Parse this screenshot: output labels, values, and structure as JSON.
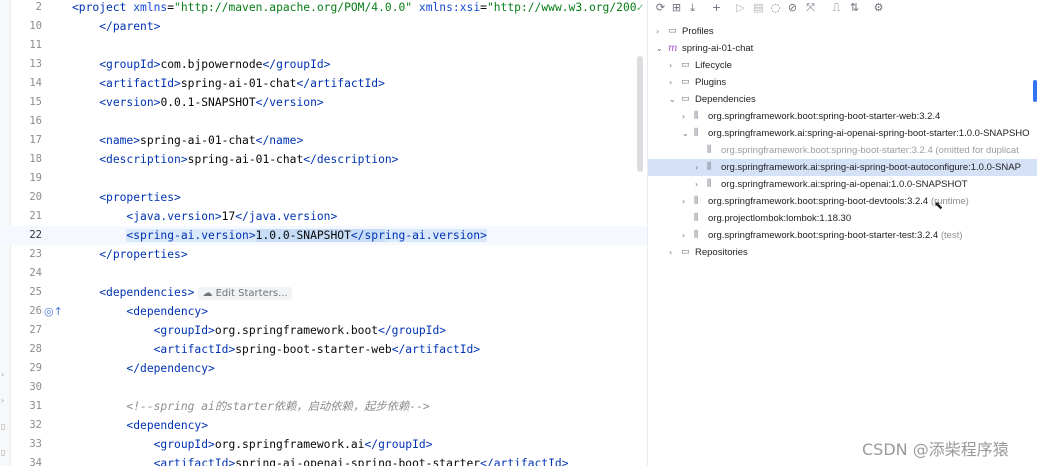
{
  "editor": {
    "lines": [
      {
        "num": "2",
        "parts": [
          [
            "tg",
            "<project "
          ],
          [
            "an",
            "xmlns"
          ],
          [
            "tx",
            "="
          ],
          [
            "av",
            "\"http://maven.apache.org/POM/4.0.0\""
          ],
          [
            "tx",
            " "
          ],
          [
            "an",
            "xmlns:xsi"
          ],
          [
            "tx",
            "="
          ],
          [
            "av",
            "\"http://www.w3.org/200"
          ],
          [
            "ok",
            "✓"
          ]
        ]
      },
      {
        "num": "10",
        "parts": [
          [
            "tx",
            "    "
          ],
          [
            "tg",
            "</parent>"
          ]
        ]
      },
      {
        "num": "11",
        "parts": []
      },
      {
        "num": "13",
        "parts": [
          [
            "tx",
            "    "
          ],
          [
            "tg",
            "<groupId>"
          ],
          [
            "tx",
            "com.bjpowernode"
          ],
          [
            "tg",
            "</groupId>"
          ]
        ]
      },
      {
        "num": "14",
        "parts": [
          [
            "tx",
            "    "
          ],
          [
            "tg",
            "<artifactId>"
          ],
          [
            "tx",
            "spring-ai-01-chat"
          ],
          [
            "tg",
            "</artifactId>"
          ]
        ]
      },
      {
        "num": "15",
        "parts": [
          [
            "tx",
            "    "
          ],
          [
            "tg",
            "<version>"
          ],
          [
            "tx",
            "0.0.1-SNAPSHOT"
          ],
          [
            "tg",
            "</version>"
          ]
        ]
      },
      {
        "num": "16",
        "parts": []
      },
      {
        "num": "17",
        "parts": [
          [
            "tx",
            "    "
          ],
          [
            "tg",
            "<name>"
          ],
          [
            "tx",
            "spring-ai-01-chat"
          ],
          [
            "tg",
            "</name>"
          ]
        ]
      },
      {
        "num": "18",
        "parts": [
          [
            "tx",
            "    "
          ],
          [
            "tg",
            "<description>"
          ],
          [
            "tx",
            "spring-ai-01-chat"
          ],
          [
            "tg",
            "</description>"
          ]
        ]
      },
      {
        "num": "19",
        "parts": []
      },
      {
        "num": "20",
        "parts": [
          [
            "tx",
            "    "
          ],
          [
            "tg",
            "<properties>"
          ]
        ]
      },
      {
        "num": "21",
        "parts": [
          [
            "tx",
            "        "
          ],
          [
            "tg",
            "<java.version>"
          ],
          [
            "tx",
            "17"
          ],
          [
            "tg",
            "</java.version>"
          ]
        ]
      },
      {
        "num": "22",
        "hl": true,
        "parts": [
          [
            "tx",
            "        "
          ],
          [
            "tg selb",
            "<spring-ai.version>"
          ],
          [
            "tx sel",
            "1.0.0-SNAPSHOT"
          ],
          [
            "tg sel",
            "</spr"
          ],
          [
            "tg selb",
            "ing-ai.version>"
          ]
        ]
      },
      {
        "num": "23",
        "parts": [
          [
            "tx",
            "    "
          ],
          [
            "tg",
            "</properties>"
          ]
        ]
      },
      {
        "num": "24",
        "parts": []
      },
      {
        "num": "25",
        "parts": [
          [
            "tx",
            "    "
          ],
          [
            "tg",
            "<dependencies>"
          ],
          [
            "hint",
            "☁ Edit Starters..."
          ]
        ]
      },
      {
        "num": "26",
        "gutter": "◎↑",
        "parts": [
          [
            "tx",
            "        "
          ],
          [
            "tg",
            "<dependency>"
          ]
        ]
      },
      {
        "num": "27",
        "parts": [
          [
            "tx",
            "            "
          ],
          [
            "tg",
            "<groupId>"
          ],
          [
            "tx",
            "org.springframework.boot"
          ],
          [
            "tg",
            "</groupId>"
          ]
        ]
      },
      {
        "num": "28",
        "parts": [
          [
            "tx",
            "            "
          ],
          [
            "tg",
            "<artifactId>"
          ],
          [
            "tx",
            "spring-boot-starter-web"
          ],
          [
            "tg",
            "</artifactId>"
          ]
        ]
      },
      {
        "num": "29",
        "parts": [
          [
            "tx",
            "        "
          ],
          [
            "tg",
            "</dependency>"
          ]
        ]
      },
      {
        "num": "30",
        "parts": []
      },
      {
        "num": "31",
        "parts": [
          [
            "tx",
            "        "
          ],
          [
            "cm",
            "<!--spring ai的starter依赖，启动依赖，起步依赖-->"
          ]
        ]
      },
      {
        "num": "32",
        "parts": [
          [
            "tx",
            "        "
          ],
          [
            "tg",
            "<dependency>"
          ]
        ]
      },
      {
        "num": "33",
        "parts": [
          [
            "tx",
            "            "
          ],
          [
            "tg",
            "<groupId>"
          ],
          [
            "tx",
            "org.springframework.ai"
          ],
          [
            "tg",
            "</groupId>"
          ]
        ]
      },
      {
        "num": "34",
        "parts": [
          [
            "tx",
            "            "
          ],
          [
            "tg",
            "<artifactId>"
          ],
          [
            "tx",
            "spring-ai-openai-spring-boot-starter"
          ],
          [
            "tg",
            "</artifactId>"
          ]
        ]
      }
    ]
  },
  "toolbar": {
    "icons": [
      "reload-icon",
      "add-project-icon",
      "download-icon",
      "plus-icon",
      "run-icon",
      "execute-goal-icon",
      "toggle-offline-icon",
      "skip-tests-icon",
      "collapse-icon",
      "show-dependencies-icon",
      "analyze-icon",
      "settings-icon"
    ]
  },
  "tree": [
    {
      "depth": 1,
      "arrow": "›",
      "icon": "▭",
      "label": "Profiles"
    },
    {
      "depth": 1,
      "arrow": "⌄",
      "icon": "m",
      "iconClass": "m-icon",
      "label": "spring-ai-01-chat"
    },
    {
      "depth": 2,
      "arrow": "›",
      "icon": "▭",
      "label": "Lifecycle"
    },
    {
      "depth": 2,
      "arrow": "›",
      "icon": "▭",
      "label": "Plugins"
    },
    {
      "depth": 2,
      "arrow": "⌄",
      "icon": "▭",
      "label": "Dependencies"
    },
    {
      "depth": 3,
      "arrow": "›",
      "icon": "⫼",
      "label": "org.springframework.boot:spring-boot-starter-web:3.2.4"
    },
    {
      "depth": 3,
      "arrow": "⌄",
      "icon": "⫼",
      "label": "org.springframework.ai:spring-ai-openai-spring-boot-starter:1.0.0-SNAPSHO"
    },
    {
      "depth": 4,
      "arrow": "",
      "icon": "⫼",
      "label": "org.springframework.boot:spring-boot-starter:3.2.4 (omitted for duplicat",
      "gray": true
    },
    {
      "depth": 4,
      "arrow": "›",
      "icon": "⫼",
      "label": "org.springframework.ai:spring-ai-spring-boot-autoconfigure:1.0.0-SNAP",
      "selected": true
    },
    {
      "depth": 4,
      "arrow": "›",
      "icon": "⫼",
      "label": "org.springframework.ai:spring-ai-openai:1.0.0-SNAPSHOT"
    },
    {
      "depth": 3,
      "arrow": "›",
      "icon": "⫼",
      "label": "org.springframework.boot:spring-boot-devtools:3.2.4",
      "suffix": " (runtime)"
    },
    {
      "depth": 3,
      "arrow": "",
      "icon": "⫼",
      "label": "org.projectlombok:lombok:1.18.30"
    },
    {
      "depth": 3,
      "arrow": "›",
      "icon": "⫼",
      "label": "org.springframework.boot:spring-boot-starter-test:3.2.4",
      "suffix": " (test)"
    },
    {
      "depth": 2,
      "arrow": "›",
      "icon": "▭",
      "label": "Repositories"
    }
  ],
  "watermark": "CSDN @添柴程序猿"
}
